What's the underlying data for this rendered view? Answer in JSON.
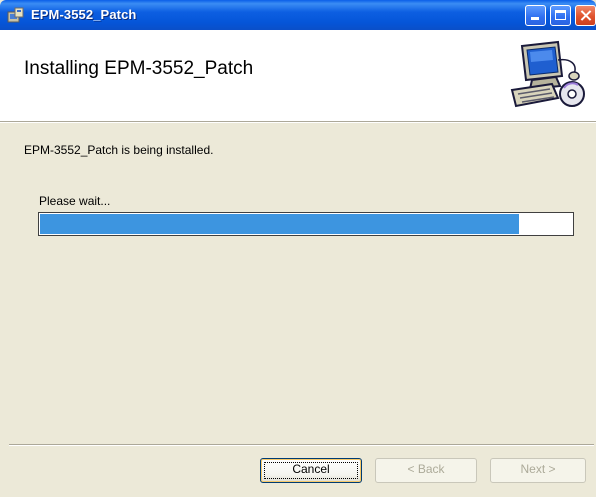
{
  "window": {
    "title": "EPM-3552_Patch"
  },
  "banner": {
    "heading": "Installing EPM-3552_Patch",
    "artwork_icon": "computer-setup-icon"
  },
  "body": {
    "status": "EPM-3552_Patch is being installed.",
    "progress_label": "Please wait...",
    "progress_fraction": 0.9
  },
  "footer": {
    "cancel_label": "Cancel",
    "back_label": "< Back",
    "next_label": "Next >"
  },
  "colors": {
    "titlebar": "#0555d8",
    "progress_fill": "#3d95e0",
    "dialog_bg": "#ece9d8"
  }
}
